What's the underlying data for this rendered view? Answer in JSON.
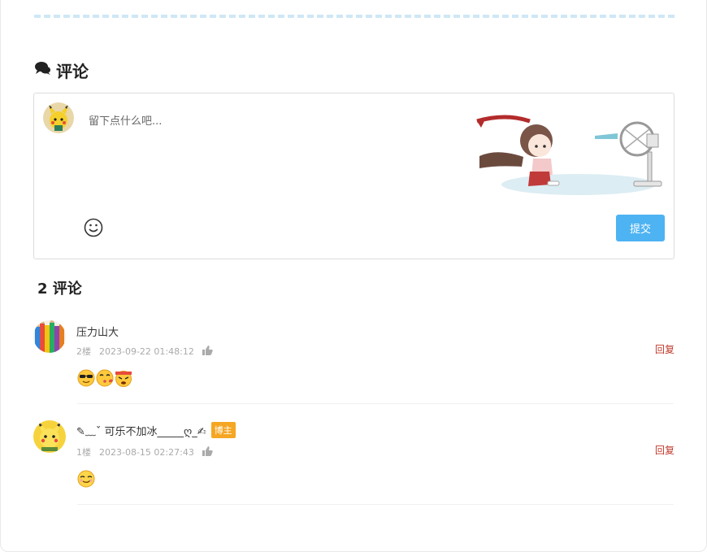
{
  "comments_section": {
    "title": "评论",
    "input_placeholder": "留下点什么吧...",
    "submit_label": "提交"
  },
  "comments": {
    "count_title": "2 评论",
    "items": [
      {
        "name": "压力山大",
        "floor": "2楼",
        "time": "2023-09-22 01:48:12",
        "reply_label": "回复",
        "emojis": [
          "cool-face-emoji",
          "kissing-face-emoji",
          "angry-headband-emoji"
        ]
      },
      {
        "name": "✎﹏ˇ 可乐不加冰_____ღ_✍",
        "badge": "博主",
        "floor": "1楼",
        "time": "2023-08-15 02:27:43",
        "reply_label": "回复",
        "emojis": [
          "smirk-face-emoji"
        ]
      }
    ]
  },
  "colors": {
    "accent": "#4db3f2",
    "reply": "#c0392b",
    "badge": "#f5a623",
    "dashed_divider": "#cfe7f6"
  }
}
